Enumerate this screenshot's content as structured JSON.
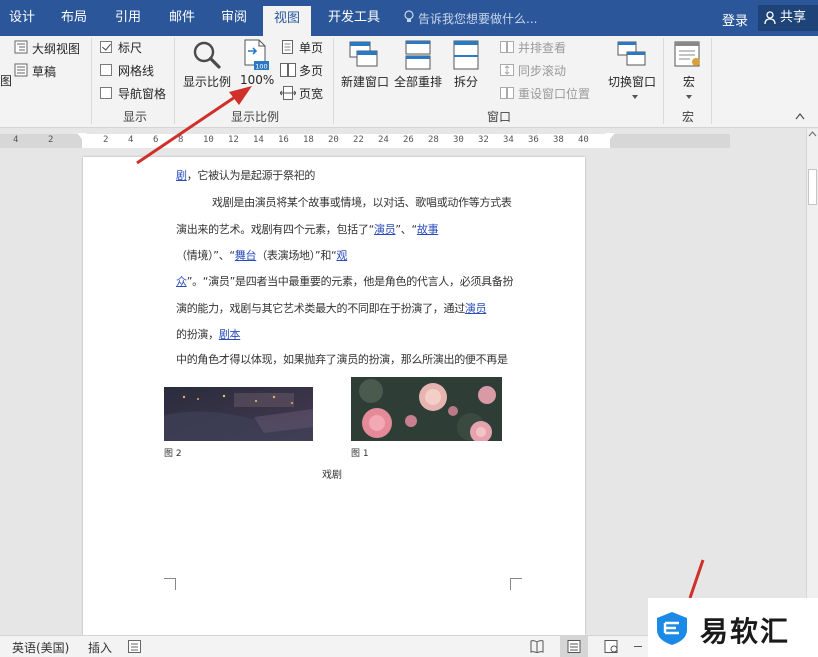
{
  "tabs": [
    "设计",
    "布局",
    "引用",
    "邮件",
    "审阅",
    "视图",
    "开发工具"
  ],
  "active_tab": "视图",
  "tell_me": "告诉我您想要做什么...",
  "login_label": "登录",
  "share_label": "共享",
  "ribbon": {
    "views": {
      "outline": "大纲视图",
      "draft": "草稿",
      "partial": "图"
    },
    "show": {
      "ruler": "标尺",
      "gridlines": "网格线",
      "nav_pane": "导航窗格",
      "label": "显示"
    },
    "zoom": {
      "zoom": "显示比例",
      "hundred": "100%",
      "hundred_icon_text": "100",
      "one_page": "单页",
      "multi_page": "多页",
      "page_width": "页宽",
      "label": "显示比例"
    },
    "window": {
      "new_window": "新建窗口",
      "arrange_all": "全部重排",
      "split": "拆分",
      "side_by_side": "并排查看",
      "sync_scroll": "同步滚动",
      "reset_position": "重设窗口位置",
      "switch_windows": "切换窗口",
      "label": "窗口"
    },
    "macros": {
      "macros": "宏",
      "label": "宏"
    }
  },
  "ruler_numbers": [
    "4",
    "2",
    "2",
    "4",
    "6",
    "8",
    "10",
    "12",
    "14",
    "16",
    "18",
    "20",
    "22",
    "24",
    "26",
    "28",
    "30",
    "32",
    "34",
    "36",
    "38",
    "40"
  ],
  "document": {
    "line1_link": "剧",
    "line1_rest": "，它被认为是起源于祭祀的",
    "line2": "戏剧是由演员将某个故事或情境，以对话、歌唱或动作等方式表",
    "line3_a": "演出来的艺术。戏剧有四个元素，包括了“",
    "line3_link1": "演员",
    "line3_b": "”、“",
    "line3_link2": "故事",
    "line4_a": "（情境）”、“",
    "line4_link1": "舞台",
    "line4_b": "（表演场地）”和“",
    "line4_link2": "观",
    "line5_link": "众",
    "line5_rest": "”。“演员”是四者当中最重要的元素，他是角色的代言人，必须具备扮",
    "line6_a": "演的能力，戏剧与其它艺术类最大的不同即在于扮演了，通过",
    "line6_link": "演员",
    "line7_a": "的扮演，",
    "line7_link": "剧本",
    "line8": "中的角色才得以体现，如果抛弃了演员的扮演，那么所演出的便不再是",
    "caption_left": "图 2",
    "caption_right": "图 1",
    "caption_center": "戏剧"
  },
  "status_bar": {
    "language": "英语(美国)",
    "insert": "插入"
  },
  "watermark": "易软汇",
  "colors": {
    "tab_bar": "#2b579a",
    "ribbon_bg": "#f3f3f3",
    "link": "#2a4dbb",
    "arrow": "#d0302a"
  }
}
